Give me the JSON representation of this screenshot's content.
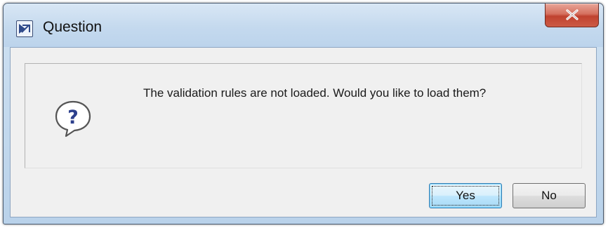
{
  "window": {
    "title": "Question",
    "app_icon": "app-window-icon",
    "close_icon": "close-icon"
  },
  "message": {
    "icon": "question-icon",
    "text": "The validation rules are not loaded. Would you like to load them?"
  },
  "buttons": {
    "yes_label": "Yes",
    "no_label": "No"
  },
  "colors": {
    "title_bar": "#c4d9ee",
    "close_button": "#c0422f",
    "content_background": "#f0f0f0",
    "question_icon": "#2c3f8c",
    "default_button": "#bee6fd"
  }
}
